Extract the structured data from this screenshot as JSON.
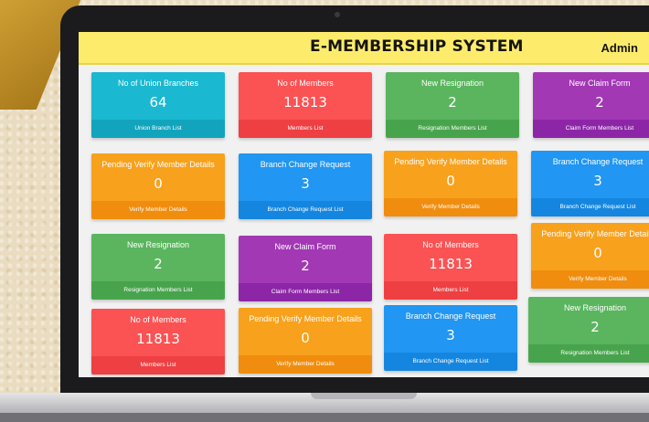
{
  "header": {
    "title": "E-MEMBERSHIP SYSTEM",
    "user": "Admin"
  },
  "cards": [
    {
      "label": "No of Union Branches",
      "value": "64",
      "link": "Union Branch List",
      "color": "#1ab8d1"
    },
    {
      "label": "No of Members",
      "value": "11813",
      "link": "Members List",
      "color": "#fb5253"
    },
    {
      "label": "New Resignation",
      "value": "2",
      "link": "Resignation Members List",
      "color": "#5ab55e"
    },
    {
      "label": "New Claim Form",
      "value": "2",
      "link": "Claim Form Members List",
      "color": "#a238b4"
    },
    {
      "label": "Pending Verify Member Details",
      "value": "0",
      "link": "Verify Member Details",
      "color": "#f8a11c"
    },
    {
      "label": "Branch Change Request",
      "value": "3",
      "link": "Branch Change Request List",
      "color": "#2196f2"
    },
    {
      "label": "Pending Verify Member Details",
      "value": "0",
      "link": "Verify Member Details",
      "color": "#f8a11c"
    },
    {
      "label": "Branch Change Request",
      "value": "3",
      "link": "Branch Change Request List",
      "color": "#2196f2"
    },
    {
      "label": "New Resignation",
      "value": "2",
      "link": "Resignation Members List",
      "color": "#5ab55e"
    },
    {
      "label": "New Claim Form",
      "value": "2",
      "link": "Claim Form Members List",
      "color": "#a238b4"
    },
    {
      "label": "No of Members",
      "value": "11813",
      "link": "Members List",
      "color": "#fb5253"
    },
    {
      "label": "Pending Verify Member Details",
      "value": "0",
      "link": "Verify Member Details",
      "color": "#f8a11c"
    },
    {
      "label": "No of Members",
      "value": "11813",
      "link": "Members List",
      "color": "#fb5253"
    },
    {
      "label": "Pending Verify Member Details",
      "value": "0",
      "link": "Verify Member Details",
      "color": "#f8a11c"
    },
    {
      "label": "Branch Change Request",
      "value": "3",
      "link": "Branch Change Request List",
      "color": "#2196f2"
    },
    {
      "label": "New Resignation",
      "value": "2",
      "link": "Resignation Members List",
      "color": "#5ab55e"
    }
  ]
}
